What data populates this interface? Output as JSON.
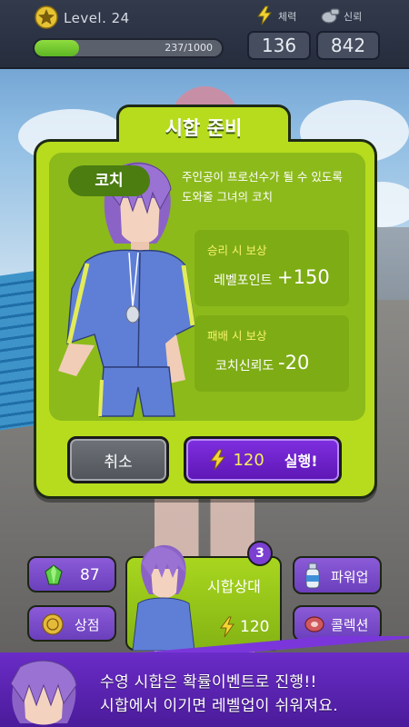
{
  "hud": {
    "level": "Level. 24",
    "xp_text": "237/1000",
    "xp_fraction": 0.237,
    "stamina_label": "체력",
    "stamina_value": "136",
    "trust_label": "신뢰",
    "trust_value": "842"
  },
  "dialog": {
    "title": "시합 준비",
    "coach_name": "코치",
    "coach_desc_line1": "주인공이 프로선수가 될 수 있도록",
    "coach_desc_line2": "도와줄 그녀의 코치",
    "win_heading": "승리 시 보상",
    "win_reward_name": "레벨포인트",
    "win_reward_value": "+150",
    "lose_heading": "패배 시 보상",
    "lose_reward_name": "코치신뢰도",
    "lose_reward_value": "-20",
    "cancel_label": "취소",
    "run_cost": "120",
    "run_label": "실행!"
  },
  "menu": {
    "gems": "87",
    "shop": "상점",
    "opponent": "시합상대",
    "opponent_badge": "3",
    "opponent_cost": "120",
    "powerup": "파워업",
    "collection": "콜렉션"
  },
  "tutorial": {
    "line1": "수영 시합은 확률이벤트로 진행!!",
    "line2": "시합에서 이기면 레벨업이 쉬워져요."
  },
  "colors": {
    "panel_green": "#b6dc1d",
    "panel_inner": "#8cba1b",
    "accent_purple": "#6b2fcf",
    "reward_heading": "#f8f36a"
  },
  "icons": [
    "star-icon",
    "lightning-icon",
    "whistle-icon",
    "gem-icon",
    "coin-icon",
    "bottle-icon",
    "meat-icon"
  ]
}
